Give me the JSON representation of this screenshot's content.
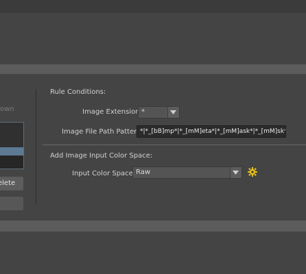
{
  "left_panel": {
    "header_label_partial": "own",
    "delete_button_label": "elete"
  },
  "rule_conditions": {
    "section_title": "Rule Conditions:",
    "image_extension_label": "Image Extension:",
    "image_extension_value": "*",
    "file_path_label": "Image File Path Pattern:",
    "file_path_value": "*|*_[bB]mp*|*_[mM]eta*|*_[mM]ask*|*_[mM]sk*"
  },
  "color_space": {
    "section_title": "Add Image Input Color Space:",
    "input_label": "Input Color Space:",
    "input_value": "Raw",
    "settings_icon_color": "#e8c21a"
  }
}
